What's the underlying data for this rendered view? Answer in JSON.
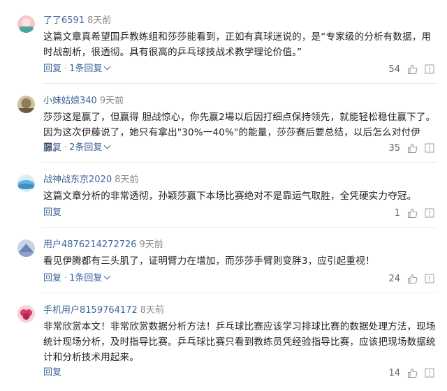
{
  "comments": [
    {
      "user": "了了6591",
      "time": "8天前",
      "text": "这篇文章真希望国乒教练组和莎莎能看到，正如有真球迷说的，是“专家级的分析有数据，用时战剖析，很透彻。具有很高的乒乓球技战术教学理论价值。”",
      "reply": "回复",
      "reply_count": "1条回复",
      "likes": "54",
      "avatar_colors": [
        "#f6c6c8",
        "#4aa79a"
      ]
    },
    {
      "user": "小妹姑娘340",
      "time": "9天前",
      "text": "莎莎这是赢了，但赢得 胆战惊心，你先赢2場以后因打细点保持领先，就能轻松稳住赢下了。因为这次伊藤说了，她只有拿出\"30%一40%\"的能量，莎莎赛后要总结，以后怎么对付伊藤。",
      "reply": "回复",
      "reply_count": "2条回复",
      "likes": "35",
      "avatar_colors": [
        "#8a7c5c",
        "#cfc29a"
      ]
    },
    {
      "user": "战神战东京2020",
      "time": "8天前",
      "text": "这篇文章分析的非常透彻，孙颖莎赢下本场比赛绝对不是靠运气取胜，全凭硬实力夺冠。",
      "reply": "回复",
      "reply_count": "",
      "likes": "1",
      "avatar_colors": [
        "#5fb3e0",
        "#d7eef8"
      ]
    },
    {
      "user": "用户4876214272726",
      "time": "9天前",
      "text": "看见伊腾都有三头肌了，证明臂力在增加，而莎莎手臂则变胖3，应引起重视！",
      "reply": "回复",
      "reply_count": "1条回复",
      "likes": "24",
      "avatar_colors": [
        "#6d83b5",
        "#c9d3e8"
      ]
    },
    {
      "user": "手机用户8159764172",
      "time": "8天前",
      "text": "非常欣赏本文！非常欣赏数据分析方法！乒乓球比赛应该学习排球比赛的数据处理方法，现场统计现场分析，及时指导比赛。乒乓球比赛只看到教练员凭经验指导比赛，应该把现场数据统计和分析技术用起来。",
      "reply": "回复",
      "reply_count": "",
      "likes": "14",
      "avatar_colors": [
        "#d23b63",
        "#f3d2dc"
      ]
    }
  ],
  "icons": {
    "like": "thumbs-up-icon",
    "report": "report-icon",
    "expand": "chevron-down-icon"
  }
}
